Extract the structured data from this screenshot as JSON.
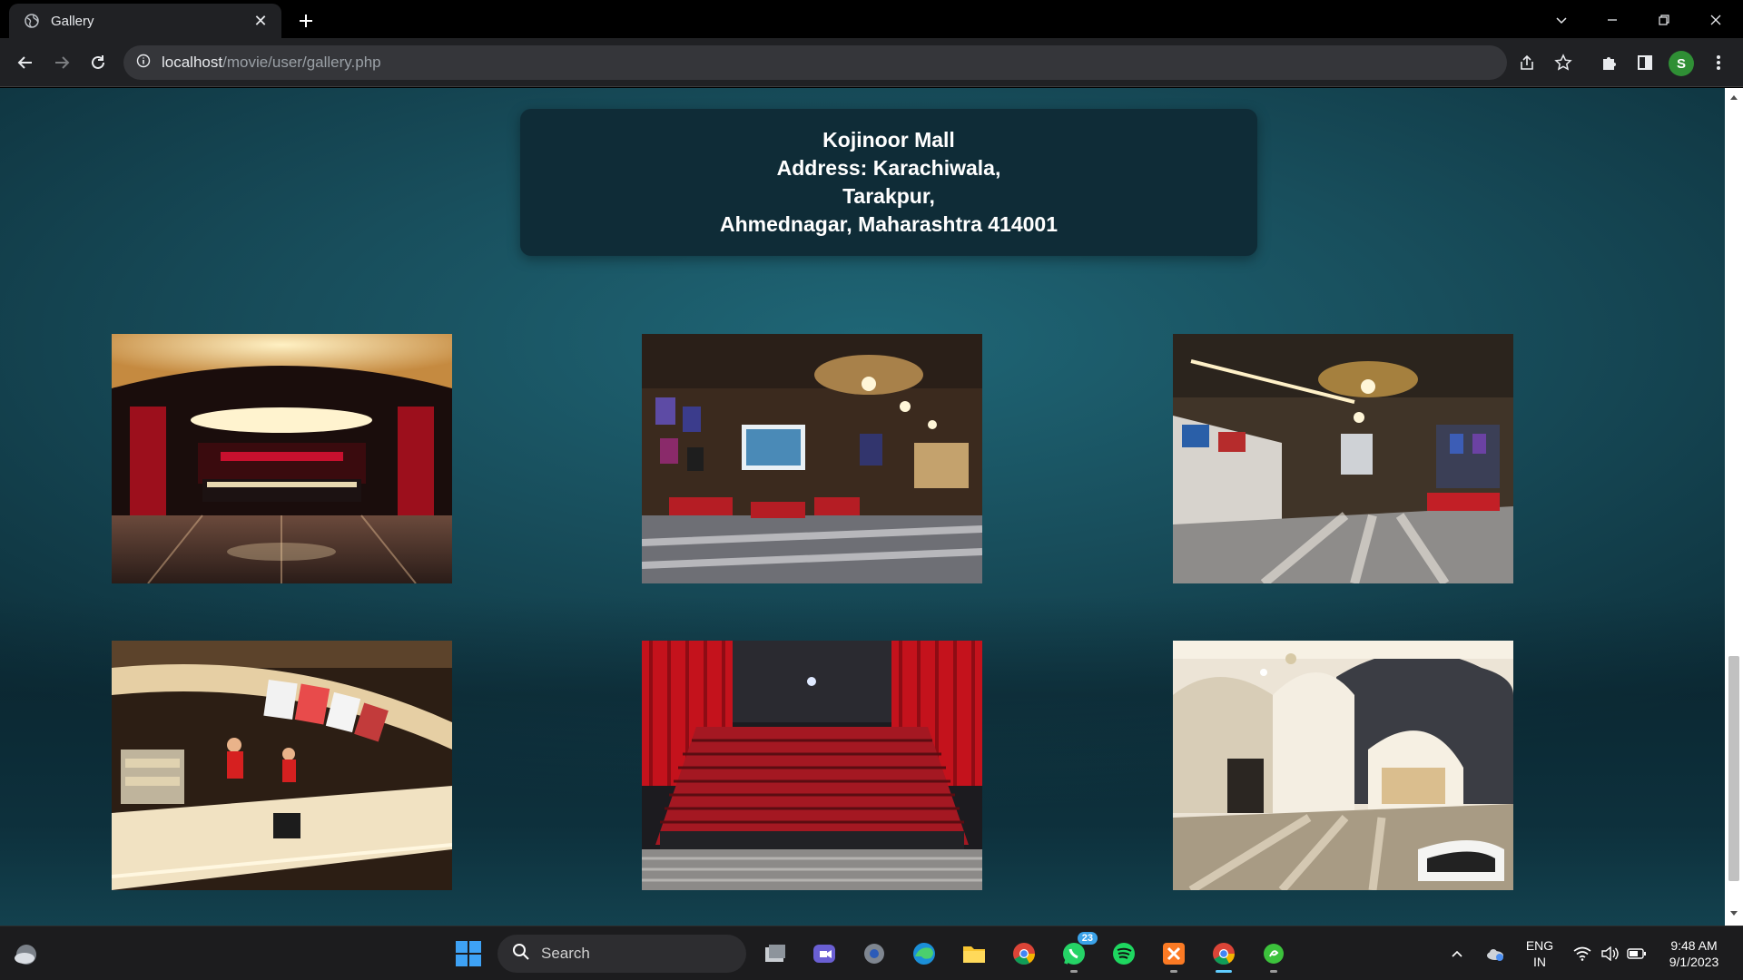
{
  "browser": {
    "tab_title": "Gallery",
    "url_host": "localhost",
    "url_path": "/movie/user/gallery.php",
    "avatar_letter": "S"
  },
  "page": {
    "address_lines": [
      "Kojinoor Mall",
      "Address: Karachiwala,",
      "Tarakpur,",
      "Ahmednagar, Maharashtra 414001"
    ],
    "gallery": [
      {
        "name": "cinema-lobby-photo"
      },
      {
        "name": "inox-lounge-photo"
      },
      {
        "name": "inox-corridor-photo"
      },
      {
        "name": "food-counter-photo"
      },
      {
        "name": "auditorium-seats-photo"
      },
      {
        "name": "white-arched-lobby-photo"
      }
    ]
  },
  "taskbar": {
    "search_label": "Search",
    "whatsapp_badge": "23",
    "language_line1": "ENG",
    "language_line2": "IN",
    "time": "9:48 AM",
    "date": "9/1/2023"
  },
  "colors": {
    "page_background": "#1f6676",
    "address_box": "#0f2c37",
    "chrome_dark": "#202124",
    "avatar": "#2f8f35"
  }
}
